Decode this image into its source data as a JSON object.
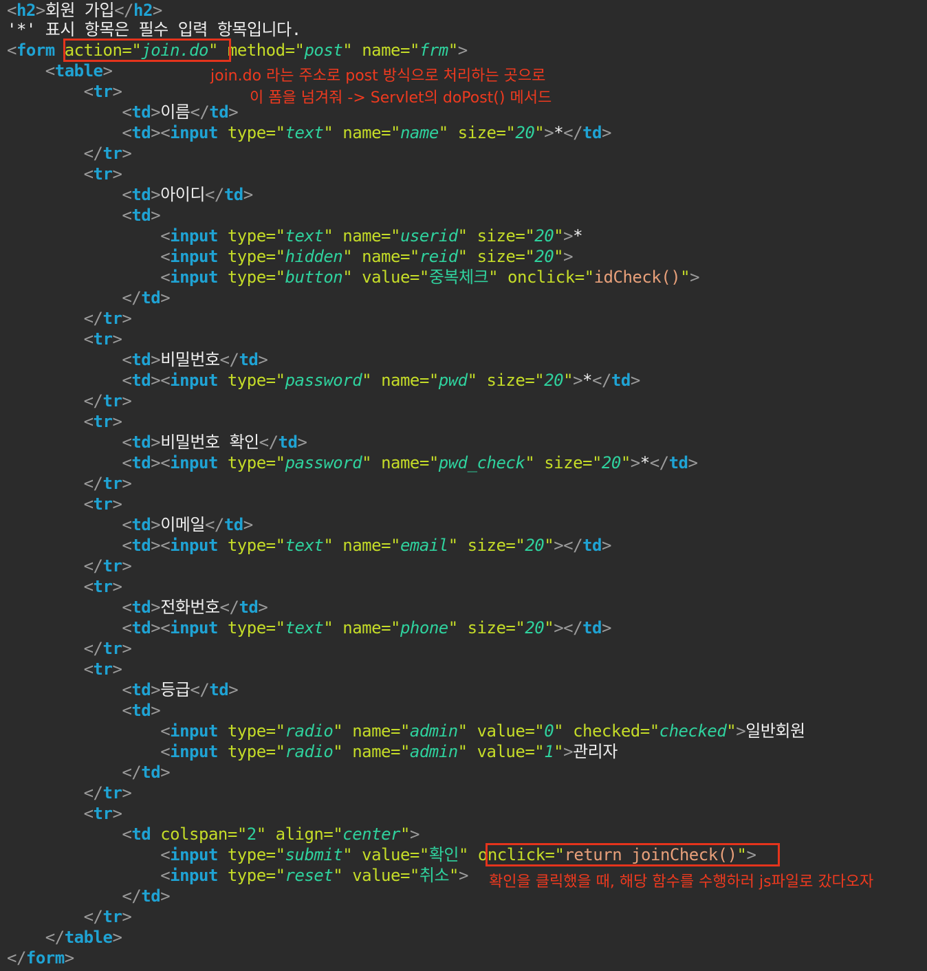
{
  "code": {
    "h2_title": "회원 가입",
    "required_note": "'*' 표시 항목은 필수 입력 항목입니다.",
    "form_action": "join.do",
    "form_method": "post",
    "form_name": "frm",
    "fields": {
      "name_label": "이름",
      "name_name": "name",
      "userid_label": "아이디",
      "userid_name": "userid",
      "reid_name": "reid",
      "dup_button_value": "중복체크",
      "dup_onclick": "idCheck()",
      "pwd_label": "비밀번호",
      "pwd_name": "pwd",
      "pwd_check_label": "비밀번호 확인",
      "pwd_check_name": "pwd_check",
      "email_label": "이메일",
      "email_name": "email",
      "phone_label": "전화번호",
      "phone_name": "phone",
      "grade_label": "등급",
      "admin_name": "admin",
      "radio0_value": "0",
      "radio0_checked": "checked",
      "radio0_text": "일반회원",
      "radio1_value": "1",
      "radio1_text": "관리자",
      "submit_value": "확인",
      "submit_onclick": "return joinCheck()",
      "reset_value": "취소",
      "size_value": "20",
      "colspan_value": "2",
      "align_value": "center",
      "type_text": "text",
      "type_hidden": "hidden",
      "type_button": "button",
      "type_password": "password",
      "type_radio": "radio",
      "type_submit": "submit",
      "type_reset": "reset",
      "asterisk": "*"
    }
  },
  "annotations": {
    "form_note_line1": "join.do 라는 주소로 post 방식으로 처리하는 곳으로",
    "form_note_line2": "이 폼을 넘겨줘 -> Servlet의 doPost() 메서드",
    "submit_note": "확인을 클릭했을 때, 해당 함수를 수행하러 js파일로 갔다오자"
  },
  "colors": {
    "background": "#2b2b2b",
    "tag": "#1fa3d4",
    "attribute": "#c5dc28",
    "string_value": "#2fd29e",
    "js_value": "#e8a07a",
    "annotation": "#ef3a1f"
  }
}
